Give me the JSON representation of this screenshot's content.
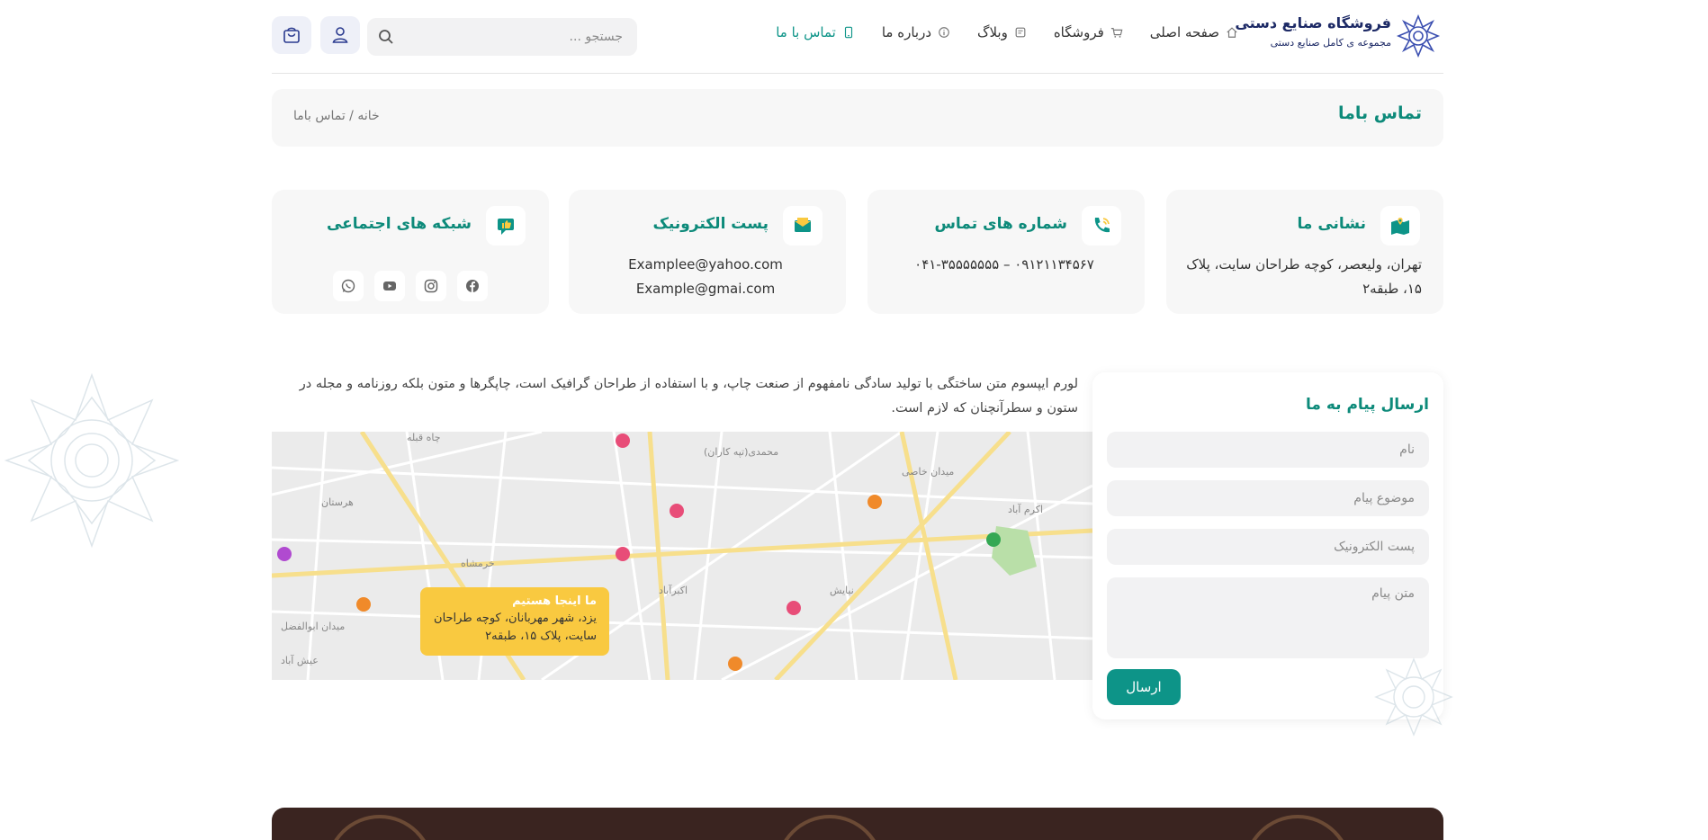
{
  "header": {
    "brand_title": "فروشگاه صنایع دستی",
    "brand_subtitle": "مجموعه ی کامل صنایع دستی",
    "nav": [
      {
        "label": "صفحه اصلی",
        "icon": "home-icon"
      },
      {
        "label": "فروشگاه",
        "icon": "cart-icon"
      },
      {
        "label": "وبلاگ",
        "icon": "blog-icon"
      },
      {
        "label": "درباره ما",
        "icon": "info-icon"
      },
      {
        "label": "تماس با ما",
        "icon": "phone-icon",
        "active": true
      }
    ],
    "search_placeholder": "جستجو ..."
  },
  "breadcrumb": {
    "title": "تماس باما",
    "path": "خانه / تماس باما"
  },
  "cards": {
    "address": {
      "title": "نشانی ما",
      "body": "تهران، ولیعصر، کوچه طراحان سایت، پلاک ۱۵، طبقه۲"
    },
    "phones": {
      "title": "شماره های تماس",
      "body": "۰۹۱۲۱۱۳۴۵۶۷ – ۰۴۱-۳۵۵۵۵۵۵۵"
    },
    "email": {
      "title": "پست الکترونیک",
      "line1": "Examplee@yahoo.com",
      "line2": "Example@gmai.com"
    },
    "social": {
      "title": "شبکه های اجتماعی",
      "icons": [
        "facebook-icon",
        "instagram-icon",
        "youtube-icon",
        "whatsapp-icon"
      ]
    }
  },
  "lorem": "لورم ایپسوم متن ساختگی با تولید سادگی نامفهوم از صنعت چاپ، و با استفاده از طراحان گرافیک است، چاپگرها و متون بلکه روزنامه و مجله در ستون و سطرآنچنان که لازم است.",
  "map": {
    "note_title": "ما اینجا هستیم",
    "note_body": "یزد، شهر مهربانان، کوچه طراحان سایت، پلاک ۱۵، طبقه۲"
  },
  "form": {
    "title": "ارسال پیام به ما",
    "name_placeholder": "نام",
    "subject_placeholder": "موضوع پیام",
    "email_placeholder": "پست الکترونیک",
    "message_placeholder": "متن پیام",
    "submit_label": "ارسال"
  },
  "colors": {
    "accent": "#0d9488",
    "brand": "#1d2a66",
    "note": "#f9c940"
  }
}
